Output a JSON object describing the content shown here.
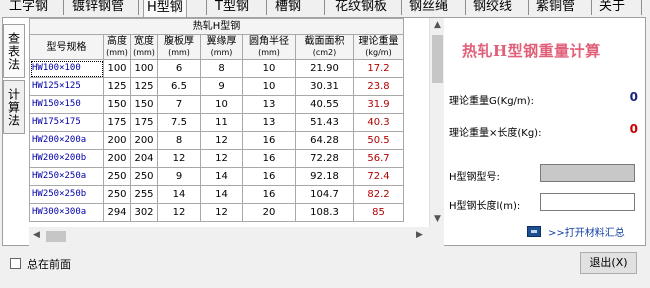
{
  "top_tabs": [
    {
      "label": "工字钢",
      "active": false
    },
    {
      "label": "镀锌钢管",
      "active": false
    },
    {
      "label": "H型钢",
      "active": true
    },
    {
      "label": "T型钢",
      "active": false
    },
    {
      "label": "槽钢",
      "active": false
    },
    {
      "label": "花纹钢板",
      "active": false
    },
    {
      "label": "钢丝绳",
      "active": false
    },
    {
      "label": "钢绞线",
      "active": false
    },
    {
      "label": "紫铜管",
      "active": false
    },
    {
      "label": "关于",
      "active": false
    }
  ],
  "side_tabs": [
    "查表法",
    "计算法"
  ],
  "table": {
    "title": "热轧H型钢",
    "headers": [
      {
        "label": "型号规格",
        "unit": ""
      },
      {
        "label": "高度",
        "unit": "(mm)"
      },
      {
        "label": "宽度",
        "unit": "(mm)"
      },
      {
        "label": "腹板厚",
        "unit": "(mm)"
      },
      {
        "label": "翼缘厚",
        "unit": "(mm)"
      },
      {
        "label": "圆角半径",
        "unit": "(mm)"
      },
      {
        "label": "截面面积",
        "unit": "(cm2)"
      },
      {
        "label": "理论重量",
        "unit": "(kg/m)"
      }
    ],
    "rows": [
      [
        "HW100×100",
        "100",
        "100",
        "6",
        "8",
        "10",
        "21.90",
        "17.2"
      ],
      [
        "HW125×125",
        "125",
        "125",
        "6.5",
        "9",
        "10",
        "30.31",
        "23.8"
      ],
      [
        "HW150×150",
        "150",
        "150",
        "7",
        "10",
        "13",
        "40.55",
        "31.9"
      ],
      [
        "HW175×175",
        "175",
        "175",
        "7.5",
        "11",
        "13",
        "51.43",
        "40.3"
      ],
      [
        "HW200×200a",
        "200",
        "200",
        "8",
        "12",
        "16",
        "64.28",
        "50.5"
      ],
      [
        "HW200×200b",
        "200",
        "204",
        "12",
        "12",
        "16",
        "72.28",
        "56.7"
      ],
      [
        "HW250×250a",
        "250",
        "250",
        "9",
        "14",
        "16",
        "92.18",
        "72.4"
      ],
      [
        "HW250×250b",
        "250",
        "255",
        "14",
        "14",
        "16",
        "104.7",
        "82.2"
      ],
      [
        "HW300×300a",
        "294",
        "302",
        "12",
        "12",
        "20",
        "108.3",
        "85"
      ]
    ]
  },
  "calculator": {
    "title": "热轧H型钢重量计算",
    "weight_label": "理论重量G(Kg/m):",
    "weight_value": "0",
    "weight_color": "#1a237e",
    "total_label": "理论重量×长度(Kg):",
    "total_value": "0",
    "total_color": "#cc0000",
    "model_label": "H型钢型号:",
    "length_label": "H型钢长度l(m):",
    "report_link": ">>打开材料汇总"
  },
  "bottom": {
    "always_on_top_label": "总在前面",
    "exit_button": "退出(X)"
  }
}
